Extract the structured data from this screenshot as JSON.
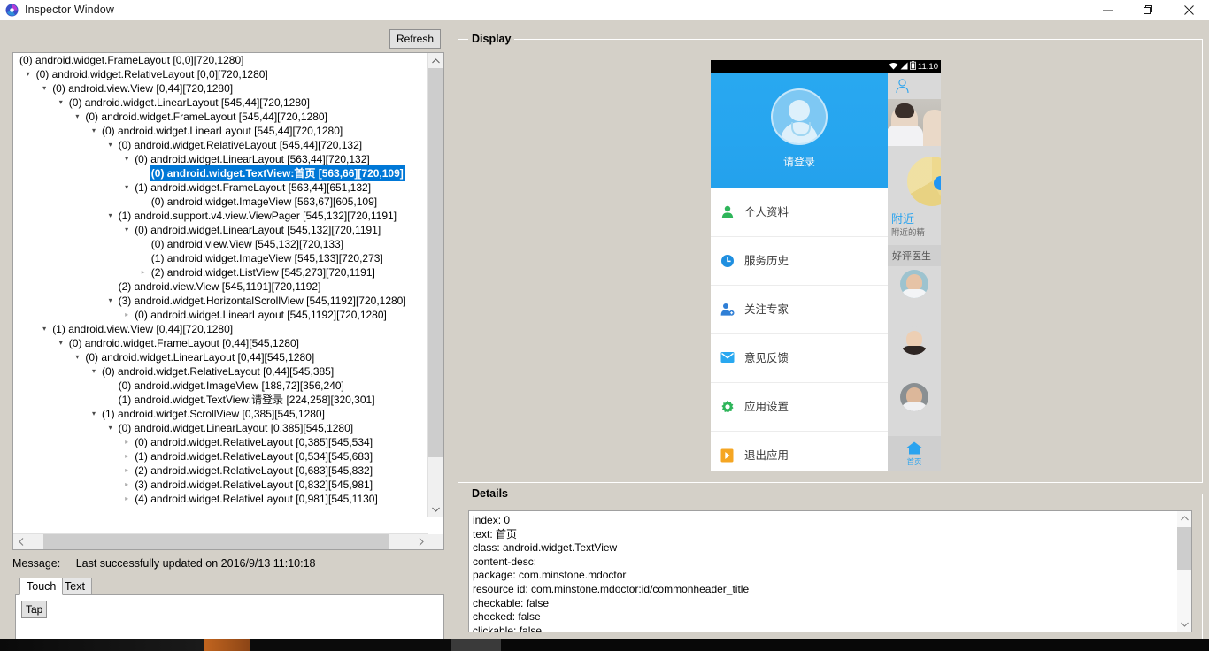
{
  "window": {
    "title": "Inspector Window",
    "icon": "app-logo-icon",
    "minimize_label": "—",
    "maximize_label": "❐",
    "close_label": "✕"
  },
  "toolbar": {
    "refresh_label": "Refresh"
  },
  "tree": {
    "selected_index": 8,
    "nodes": [
      {
        "depth": 0,
        "arrow": "none",
        "label": "(0) android.widget.FrameLayout [0,0][720,1280]"
      },
      {
        "depth": 1,
        "arrow": "open",
        "label": "(0) android.widget.RelativeLayout [0,0][720,1280]"
      },
      {
        "depth": 2,
        "arrow": "open",
        "label": "(0) android.view.View [0,44][720,1280]"
      },
      {
        "depth": 3,
        "arrow": "open",
        "label": "(0) android.widget.LinearLayout [545,44][720,1280]"
      },
      {
        "depth": 4,
        "arrow": "open",
        "label": "(0) android.widget.FrameLayout [545,44][720,1280]"
      },
      {
        "depth": 5,
        "arrow": "open",
        "label": "(0) android.widget.LinearLayout [545,44][720,1280]"
      },
      {
        "depth": 6,
        "arrow": "open",
        "label": "(0) android.widget.RelativeLayout [545,44][720,132]"
      },
      {
        "depth": 7,
        "arrow": "open",
        "label": "(0) android.widget.LinearLayout [563,44][720,132]"
      },
      {
        "depth": 8,
        "arrow": "none",
        "label": "(0) android.widget.TextView:首页 [563,66][720,109]"
      },
      {
        "depth": 7,
        "arrow": "open",
        "label": "(1) android.widget.FrameLayout [563,44][651,132]"
      },
      {
        "depth": 8,
        "arrow": "none",
        "label": "(0) android.widget.ImageView [563,67][605,109]"
      },
      {
        "depth": 6,
        "arrow": "open",
        "label": "(1) android.support.v4.view.ViewPager [545,132][720,1191]"
      },
      {
        "depth": 7,
        "arrow": "open",
        "label": "(0) android.widget.LinearLayout [545,132][720,1191]"
      },
      {
        "depth": 8,
        "arrow": "none",
        "label": "(0) android.view.View [545,132][720,133]"
      },
      {
        "depth": 8,
        "arrow": "none",
        "label": "(1) android.widget.ImageView [545,133][720,273]"
      },
      {
        "depth": 8,
        "arrow": "closed",
        "label": "(2) android.widget.ListView [545,273][720,1191]"
      },
      {
        "depth": 6,
        "arrow": "none",
        "label": "(2) android.view.View [545,1191][720,1192]"
      },
      {
        "depth": 6,
        "arrow": "open",
        "label": "(3) android.widget.HorizontalScrollView [545,1192][720,1280]"
      },
      {
        "depth": 7,
        "arrow": "closed",
        "label": "(0) android.widget.LinearLayout [545,1192][720,1280]"
      },
      {
        "depth": 2,
        "arrow": "open",
        "label": "(1) android.view.View [0,44][720,1280]"
      },
      {
        "depth": 3,
        "arrow": "open",
        "label": "(0) android.widget.FrameLayout [0,44][545,1280]"
      },
      {
        "depth": 4,
        "arrow": "open",
        "label": "(0) android.widget.LinearLayout [0,44][545,1280]"
      },
      {
        "depth": 5,
        "arrow": "open",
        "label": "(0) android.widget.RelativeLayout [0,44][545,385]"
      },
      {
        "depth": 6,
        "arrow": "none",
        "label": "(0) android.widget.ImageView [188,72][356,240]"
      },
      {
        "depth": 6,
        "arrow": "none",
        "label": "(1) android.widget.TextView:请登录 [224,258][320,301]"
      },
      {
        "depth": 5,
        "arrow": "open",
        "label": "(1) android.widget.ScrollView [0,385][545,1280]"
      },
      {
        "depth": 6,
        "arrow": "open",
        "label": "(0) android.widget.LinearLayout [0,385][545,1280]"
      },
      {
        "depth": 7,
        "arrow": "closed",
        "label": "(0) android.widget.RelativeLayout [0,385][545,534]"
      },
      {
        "depth": 7,
        "arrow": "closed",
        "label": "(1) android.widget.RelativeLayout [0,534][545,683]"
      },
      {
        "depth": 7,
        "arrow": "closed",
        "label": "(2) android.widget.RelativeLayout [0,683][545,832]"
      },
      {
        "depth": 7,
        "arrow": "closed",
        "label": "(3) android.widget.RelativeLayout [0,832][545,981]"
      },
      {
        "depth": 7,
        "arrow": "closed",
        "label": "(4) android.widget.RelativeLayout [0,981][545,1130]"
      }
    ]
  },
  "status": {
    "message_label": "Message:",
    "message_value": "Last successfully updated on 2016/9/13 11:10:18"
  },
  "action_tabs": {
    "tabs": [
      {
        "label": "Touch",
        "active": true
      },
      {
        "label": "Text",
        "active": false
      }
    ],
    "tap_label": "Tap"
  },
  "display": {
    "title": "Display"
  },
  "details": {
    "title": "Details",
    "lines": [
      "index: 0",
      "text: 首页",
      "class: android.widget.TextView",
      "content-desc:",
      "package: com.minstone.mdoctor",
      "resource id: com.minstone.mdoctor:id/commonheader_title",
      "checkable: false",
      "checked: false",
      "clickable: false"
    ]
  },
  "phone": {
    "statusbar": {
      "clock": "11:10",
      "icons": [
        "wifi-icon",
        "signal-icon",
        "battery-icon"
      ]
    },
    "drawer": {
      "login_text": "请登录",
      "avatar_icon": "doctor-avatar-icon",
      "items": [
        {
          "label": "个人资料",
          "icon": "person-icon",
          "color": "#2eb55a"
        },
        {
          "label": "服务历史",
          "icon": "clock-icon",
          "color": "#1f8fe0"
        },
        {
          "label": "关注专家",
          "icon": "follow-icon",
          "color": "#2f7fd6"
        },
        {
          "label": "意见反馈",
          "icon": "mail-icon",
          "color": "#29a8f0"
        },
        {
          "label": "应用设置",
          "icon": "gear-icon",
          "color": "#2eb55a"
        },
        {
          "label": "退出应用",
          "icon": "exit-icon",
          "color": "#f5a623"
        }
      ]
    },
    "underlay": {
      "nearby_title": "附近",
      "nearby_sub": "附近的精",
      "section_title": "好评医生",
      "home_label": "首页",
      "person_icon": "person-outline-icon",
      "home_icon": "home-icon"
    }
  },
  "colors": {
    "accent_blue": "#29a8f0",
    "selection_blue": "#0078d7",
    "window_bg": "#d4d0c8",
    "panel_white": "#ffffff"
  }
}
